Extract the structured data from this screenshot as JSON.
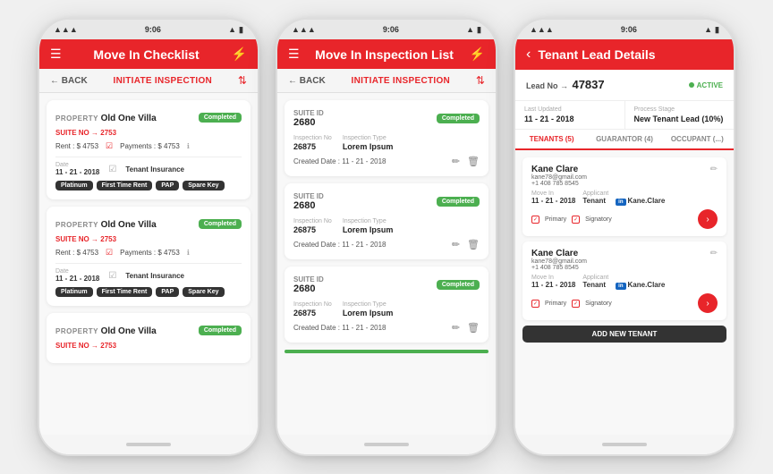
{
  "colors": {
    "red": "#e8252a",
    "green": "#4caf50",
    "dark": "#333",
    "blue": "#1565c0"
  },
  "phone1": {
    "statusBar": {
      "time": "9:06"
    },
    "header": {
      "title": "Move In Checklist"
    },
    "subHeader": {
      "back": "← BACK",
      "action": "INITIATE INSPECTION"
    },
    "cards": [
      {
        "propLabel": "PROPERTY",
        "propName": "Old One Villa",
        "badge": "Completed",
        "suiteLabel": "SUITE NO →",
        "suiteNo": "2753",
        "rent": "Rent : $ 4753",
        "payments": "Payments : $ 4753",
        "dateLabel": "Date",
        "date": "11 - 21 - 2018",
        "insurance": "Tenant Insurance",
        "tags": [
          "Platinum",
          "First Time Rent",
          "PAP",
          "Spare Key"
        ]
      },
      {
        "propLabel": "PROPERTY",
        "propName": "Old One Villa",
        "badge": "Completed",
        "suiteLabel": "SUITE NO →",
        "suiteNo": "2753",
        "rent": "Rent : $ 4753",
        "payments": "Payments : $ 4753",
        "dateLabel": "Date",
        "date": "11 - 21 - 2018",
        "insurance": "Tenant Insurance",
        "tags": [
          "Platinum",
          "First Time Rent",
          "PAP",
          "Spare Key"
        ]
      },
      {
        "propLabel": "PROPERTY",
        "propName": "Old One Villa",
        "badge": "Completed",
        "suiteLabel": "SUITE NO →",
        "suiteNo": "2753",
        "partialOnly": true
      }
    ]
  },
  "phone2": {
    "statusBar": {
      "time": "9:06"
    },
    "header": {
      "title": "Move In Inspection List"
    },
    "subHeader": {
      "back": "← BACK",
      "action": "INITIATE INSPECTION"
    },
    "cards": [
      {
        "suiteIdLabel": "SUITE ID",
        "suiteId": "2680",
        "badge": "Completed",
        "inspNoLabel": "Inspection No",
        "inspNo": "26875",
        "inspTypeLabel": "Inspection Type",
        "inspType": "Lorem Ipsum",
        "createdLabel": "Created Date :",
        "createdDate": "11 - 21 - 2018"
      },
      {
        "suiteIdLabel": "SUITE ID",
        "suiteId": "2680",
        "badge": "Completed",
        "inspNoLabel": "Inspection No",
        "inspNo": "26875",
        "inspTypeLabel": "Inspection Type",
        "inspType": "Lorem Ipsum",
        "createdLabel": "Created Date :",
        "createdDate": "11 - 21 - 2018"
      },
      {
        "suiteIdLabel": "SUITE ID",
        "suiteId": "2680",
        "badge": "Completed",
        "inspNoLabel": "Inspection No",
        "inspNo": "26875",
        "inspTypeLabel": "Inspection Type",
        "inspType": "Lorem Ipsum",
        "createdLabel": "Created Date :",
        "createdDate": "11 - 21 - 2018"
      }
    ]
  },
  "phone3": {
    "statusBar": {
      "time": "9:06"
    },
    "header": {
      "title": "Tenant Lead Details"
    },
    "leadNo": "47837",
    "leadNoLabel": "Lead No →",
    "activeBadge": "ACTIVE",
    "lastUpdatedLabel": "Last Updated",
    "lastUpdated": "11 - 21 - 2018",
    "processStageLabel": "Process Stage",
    "processStage": "New Tenant Lead (10%)",
    "tabs": [
      {
        "label": "TENANTS (5)",
        "active": true
      },
      {
        "label": "GUARANTOR (4)",
        "active": false
      },
      {
        "label": "OCCUPANT (...)",
        "active": false
      }
    ],
    "tenants": [
      {
        "name": "Kane Clare",
        "email": "kane78@gmail.com",
        "phone": "+1 408 785 8545",
        "moveInLabel": "Move In",
        "moveIn": "11 - 21 - 2018",
        "applicantLabel": "Applicant",
        "applicant": "Tenant",
        "linkedLabel": "in",
        "linked": "Kane.Clare",
        "primary": true,
        "signatory": true
      },
      {
        "name": "Kane Clare",
        "email": "kane78@gmail.com",
        "phone": "+1 408 785 8545",
        "moveInLabel": "Move In",
        "moveIn": "11 - 21 - 2018",
        "applicantLabel": "Applicant",
        "applicant": "Tenant",
        "linkedLabel": "in",
        "linked": "Kane.Clare",
        "primary": true,
        "signatory": true,
        "showAddButton": true
      }
    ],
    "addTenantLabel": "ADD NEW TENANT"
  }
}
